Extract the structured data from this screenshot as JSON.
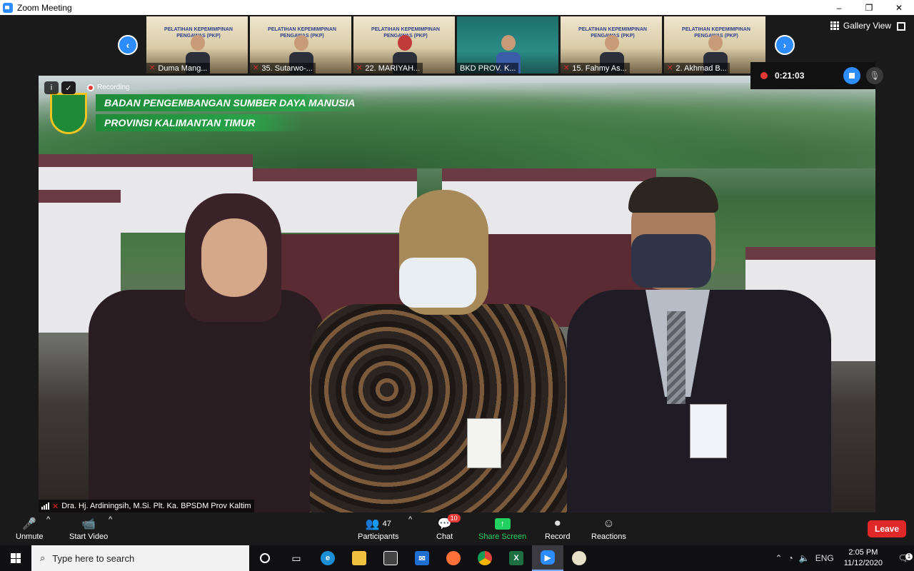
{
  "window": {
    "title": "Zoom Meeting",
    "minimize": "–",
    "restore": "❐",
    "close": "✕"
  },
  "strip": {
    "prev": "‹",
    "next": "›",
    "thumbnails": [
      {
        "name": "Duma Mang...",
        "banner": "PELATIHAN KEPEMIMPINAN PENGAWAS (PKP)"
      },
      {
        "name": "35. Sutarwo-...",
        "banner": "PELATIHAN KEPEMIMPINAN PENGAWAS (PKP)"
      },
      {
        "name": "22. MARIYAH...",
        "banner": "PELATIHAN KEPEMIMPINAN PENGAWAS (PKP)"
      },
      {
        "name": "BKD PROV. K...",
        "banner": ""
      },
      {
        "name": "15. Fahmy As...",
        "banner": "PELATIHAN KEPEMIMPINAN PENGAWAS (PKP)"
      },
      {
        "name": "2. Akhmad B...",
        "banner": "PELATIHAN KEPEMIMPINAN PENGAWAS (PKP)"
      }
    ],
    "gallery_view": "Gallery View"
  },
  "video": {
    "brand_line1": "BADAN PENGEMBANGAN SUMBER DAYA MANUSIA",
    "brand_line2": "PROVINSI KALIMANTAN TIMUR",
    "recording_label": "Recording",
    "speaker": "Dra. Hj. Ardiningsih, M.Si. Plt. Ka. BPSDM Prov Kaltim",
    "info_icon": "i",
    "shield_icon": "✓"
  },
  "recording": {
    "elapsed": "0:21:03"
  },
  "toolbar": {
    "unmute": "Unmute",
    "start_video": "Start Video",
    "participants": "Participants",
    "participant_count": "47",
    "chat": "Chat",
    "chat_badge": "10",
    "share_screen": "Share Screen",
    "record": "Record",
    "reactions": "Reactions",
    "leave": "Leave",
    "caret": "^"
  },
  "taskbar": {
    "search_placeholder": "Type here to search",
    "time": "2:05 PM",
    "date": "11/12/2020",
    "notification_count": "1",
    "apps": [
      {
        "id": "cortana",
        "label": ""
      },
      {
        "id": "task-view",
        "label": ""
      },
      {
        "id": "edge",
        "label": "e"
      },
      {
        "id": "file-explorer",
        "label": ""
      },
      {
        "id": "store",
        "label": ""
      },
      {
        "id": "mail",
        "label": ""
      },
      {
        "id": "firefox",
        "label": ""
      },
      {
        "id": "chrome",
        "label": ""
      },
      {
        "id": "excel",
        "label": "X"
      },
      {
        "id": "zoom",
        "label": ""
      },
      {
        "id": "paint",
        "label": ""
      }
    ]
  },
  "colors": {
    "accent": "#2D8CFF",
    "leave": "#E02828",
    "share": "#23D160",
    "recording": "#E53935"
  }
}
